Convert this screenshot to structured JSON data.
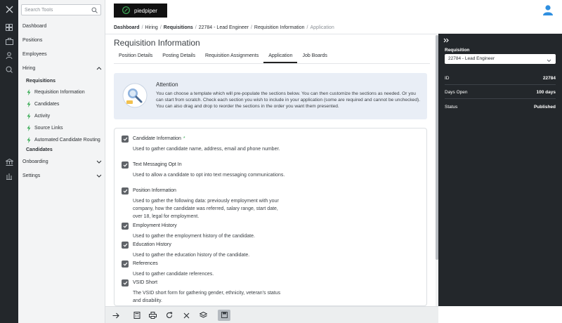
{
  "sidebar": {
    "search_placeholder": "Search Tools",
    "items": [
      {
        "label": "Dashboard"
      },
      {
        "label": "Positions"
      },
      {
        "label": "Employees"
      },
      {
        "label": "Hiring"
      },
      {
        "label": "Onboarding"
      },
      {
        "label": "Settings"
      }
    ],
    "hiring": {
      "requisitions": "Requisitions",
      "children": [
        {
          "label": "Requisition Information",
          "icon": "bolt-icon"
        },
        {
          "label": "Candidates",
          "icon": "bolt-icon"
        },
        {
          "label": "Activity",
          "icon": "bolt-icon"
        },
        {
          "label": "Source Links",
          "icon": "bolt-icon"
        },
        {
          "label": "Automated Candidate Routing",
          "icon": "bolt-icon"
        }
      ],
      "candidates": "Candidates"
    }
  },
  "header": {
    "logo_text": "piedpiper"
  },
  "breadcrumb": [
    "Dashboard",
    "Hiring",
    "Requisitions",
    "22784 - Lead Engineer",
    "Requisition Information",
    "Application"
  ],
  "page": {
    "title": "Requisition Information",
    "tabs": [
      {
        "label": "Position Details"
      },
      {
        "label": "Posting Details"
      },
      {
        "label": "Requisition Assignments"
      },
      {
        "label": "Application"
      },
      {
        "label": "Job Boards"
      }
    ],
    "active_tab": "Application"
  },
  "attention": {
    "title": "Attention",
    "text": "You can choose a template which will pre-populate the sections below. You can then customize the sections as needed. Or you can start from scratch. Check each section you wish to include in your application (some are required and cannot be unchecked). You can also drag and drop to reorder the sections in the order you want them presented."
  },
  "sections": [
    {
      "label": "Candidate Information",
      "required_mark": "*",
      "desc": "Used to gather candidate name, address, email and phone number.",
      "checked": true
    },
    {
      "label": "Text Messaging Opt In",
      "required_mark": "",
      "desc": "Used to allow a candidate to opt into text messaging communications.",
      "checked": true
    },
    {
      "label": "Position Information",
      "required_mark": "",
      "desc": "Used to gather the following data: previously employment with your company, how the candidate was referred, salary range, start date, over 18, legal for employment.",
      "checked": true
    },
    {
      "label": "Employment History",
      "required_mark": "",
      "desc": "Used to gather the employment history of the candidate.",
      "checked": true
    },
    {
      "label": "Education History",
      "required_mark": "",
      "desc": "Used to gather the education history of the candidate.",
      "checked": true
    },
    {
      "label": "References",
      "required_mark": "",
      "desc": "Used to gather candidate references.",
      "checked": true
    },
    {
      "label": "VSID Short",
      "required_mark": "",
      "desc": "The VSID short form for gathering gender, ethnicity, veteran's status and disability.",
      "checked": true
    }
  ],
  "panel": {
    "requisition_label": "Requisition",
    "requisition_value": "22784 - Lead Engineer",
    "rows": [
      {
        "key": "ID",
        "value": "22784"
      },
      {
        "key": "Days Open",
        "value": "100 days"
      },
      {
        "key": "Status",
        "value": "Published"
      }
    ]
  },
  "toolbar": {
    "icons": [
      "arrow-right-icon",
      "calculator-icon",
      "print-icon",
      "refresh-icon",
      "close-icon",
      "layers-icon",
      "save-icon"
    ]
  },
  "colors": {
    "rail": "#23272b",
    "panel": "#23272b",
    "accent_green": "#3fae5a",
    "attention_bg": "#e9eef6",
    "avatar_blue": "#2f8fe0"
  }
}
